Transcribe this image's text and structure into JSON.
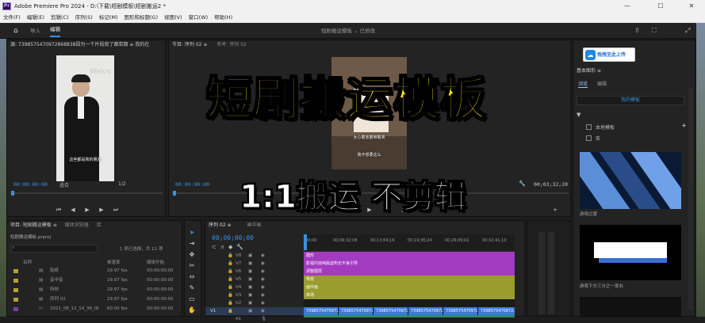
{
  "window": {
    "title": "Adobe Premiere Pro 2024 - D:\\下载\\短剧模板\\短剧搬运2 *",
    "logo": "Pr",
    "min": "—",
    "max": "☐",
    "close": "✕"
  },
  "menu": [
    "文件(F)",
    "编辑(E)",
    "剪辑(C)",
    "序列(S)",
    "标记(M)",
    "图形和标题(G)",
    "视图(V)",
    "窗口(W)",
    "帮助(H)"
  ],
  "workspace": {
    "tabs": [
      "导入",
      "编辑"
    ],
    "project_title": "短剧搬运模板 ⌄ 已修改"
  },
  "source_monitor": {
    "tab": "源: 7398575470972868838因为一个片段背了都若期 ≡ 我的在",
    "timecode_left": "00:00:00:00",
    "fit": "适合",
    "scale": "1/2",
    "caption": "这些都是我的朋友",
    "bg_text": "Welco"
  },
  "program_monitor": {
    "tab": "节目: 序列 02 ≡",
    "ref": "参考: 序列 02",
    "timecode_left": "00:00:00:00",
    "timecode_right": "00;03;32;20",
    "caption1": "女心着放着带着哭",
    "caption2": "我不想要这么"
  },
  "overlay": {
    "title": "短剧搬运模板",
    "subtitle": "1:1搬运 不剪辑"
  },
  "controls": [
    "⏮",
    "◀",
    "◀|",
    "▶",
    "|▶",
    "▶▶"
  ],
  "project_panel": {
    "tab1": "项目: 短剧搬运模板 ≡",
    "tab2": "媒体浏览器",
    "tab3": "库",
    "file": "短剧搬运模板.prproj",
    "selected": "1 项已选择，共 11 项",
    "search_placeholder": "",
    "col_name": "名称",
    "col_fps": "帧速率",
    "col_start": "媒体开始",
    "items": [
      {
        "name": "贴纸",
        "fps": "29.97 fps",
        "start": "00:00:00:00",
        "color": "#b5a13b"
      },
      {
        "name": "音中音",
        "fps": "29.97 fps",
        "start": "00:00:00:00",
        "color": "#b5a13b"
      },
      {
        "name": "特效",
        "fps": "29.97 fps",
        "start": "00:00:00:00",
        "color": "#b5a13b"
      },
      {
        "name": "序列 02",
        "fps": "29.97 fps",
        "start": "00:00:00:00",
        "color": "#b5a13b"
      },
      {
        "name": "2021_08_12_14_38_IN",
        "fps": "60.00 fps",
        "start": "00:00:00:00",
        "color": "#7a3fa8"
      }
    ]
  },
  "timeline": {
    "tab": "序列 02 ≡",
    "tab2": "画中画",
    "timecode": "00;00;00;00",
    "ruler": [
      "00;00",
      "00;06;32;08",
      "00;13;04;16",
      "00;19;36;24",
      "00;26;09;02",
      "00;32;41;10"
    ],
    "tracks": [
      {
        "label": "V8"
      },
      {
        "label": "V7"
      },
      {
        "label": "V6"
      },
      {
        "label": "V5"
      },
      {
        "label": "V4"
      },
      {
        "label": "V3"
      },
      {
        "label": "V2"
      },
      {
        "label": "V1"
      },
      {
        "label": "A1"
      }
    ],
    "clips": [
      {
        "label": "图形",
        "color": "#a33bc0",
        "track": 0
      },
      {
        "label": "影视内容纯属虚构无不良引导",
        "color": "#a33bc0",
        "track": 1
      },
      {
        "label": "调整图层",
        "color": "#a33bc0",
        "track": 2
      },
      {
        "label": "特效",
        "color": "#9a9d2e",
        "track": 3
      },
      {
        "label": "画中画",
        "color": "#9a9d2e",
        "track": 4
      },
      {
        "label": "转场",
        "color": "#9a9d2e",
        "track": 5
      }
    ],
    "v1_clips": [
      "7398575470972...",
      "7398575470972...",
      "7398575470972...",
      "7398575470972...",
      "7398575470972...",
      "7398575470972..."
    ]
  },
  "essential_graphics": {
    "tab": "基本图形 ≡",
    "tab_browse": "浏览",
    "tab_edit": "编辑",
    "library": "我的模板",
    "local_templates": "本地模板",
    "local_sub": "库",
    "cloud_button": "拖拽至此上传",
    "items": [
      {
        "label": "游戏过渡",
        "accent": "#5a8fd8"
      },
      {
        "label": "游戏下方三分之一靠右",
        "accent": "#3a6fd0"
      }
    ]
  },
  "colors": {
    "accent": "#3a8fe0",
    "purple_clip": "#a33bc0",
    "olive_clip": "#9a9d2e",
    "overlay_yellow": "#f7e11f"
  }
}
